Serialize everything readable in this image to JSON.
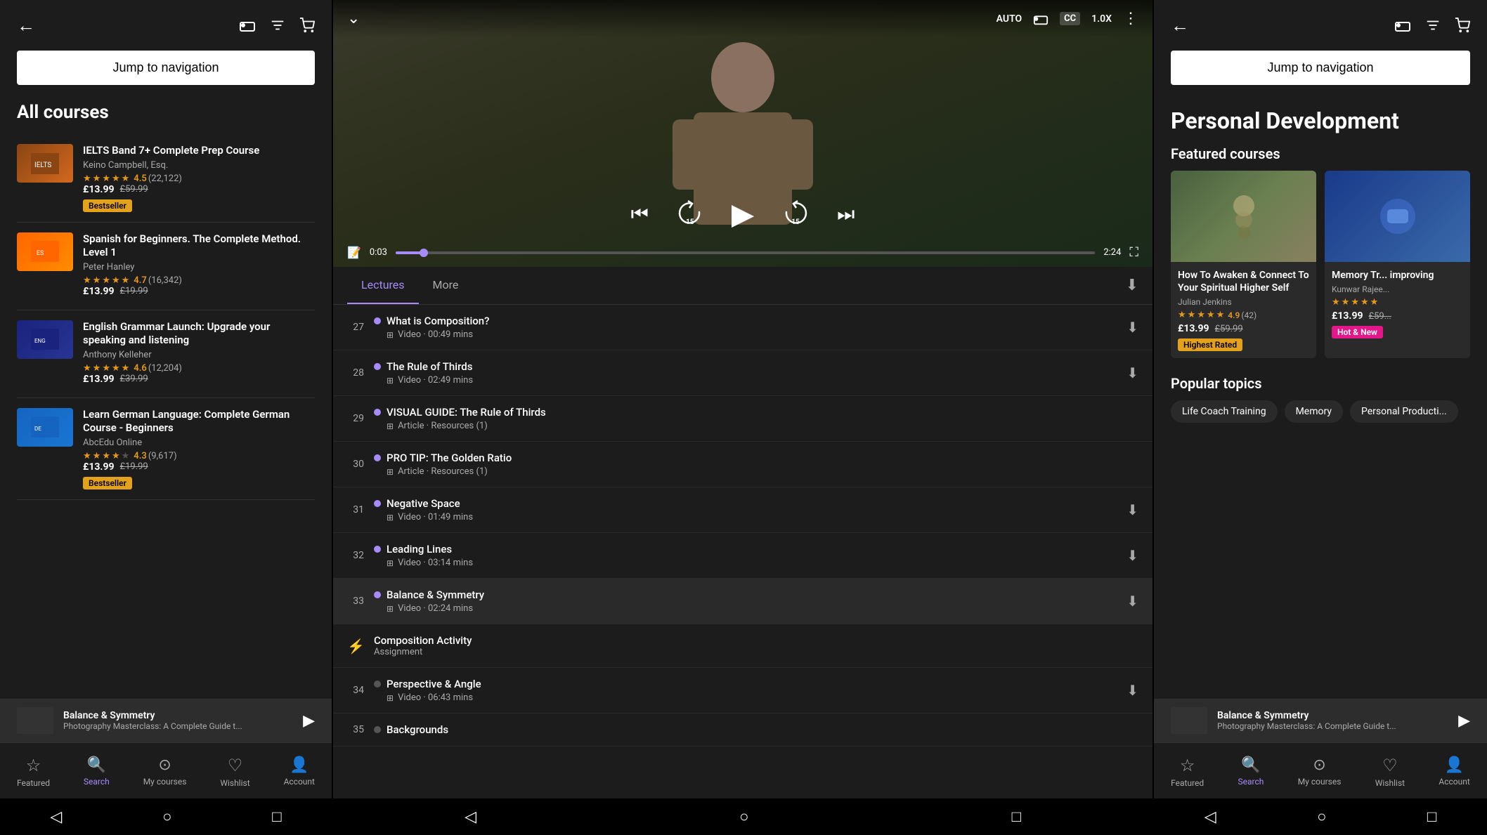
{
  "left": {
    "title": "All courses",
    "jump_nav": "Jump to navigation",
    "courses": [
      {
        "id": "ielts",
        "title": "IELTS Band 7+ Complete Prep Course",
        "author": "Keino Campbell, Esq.",
        "rating": "4.5",
        "rating_count": "(22,122)",
        "price": "£13.99",
        "original_price": "£59.99",
        "badge": "Bestseller",
        "badge_type": "bestseller",
        "stars": [
          1,
          1,
          1,
          1,
          0.5
        ]
      },
      {
        "id": "spanish",
        "title": "Spanish for Beginners. The Complete Method. Level 1",
        "author": "Peter Hanley",
        "rating": "4.7",
        "rating_count": "(16,342)",
        "price": "£13.99",
        "original_price": "£19.99",
        "badge": "",
        "badge_type": "",
        "stars": [
          1,
          1,
          1,
          1,
          1
        ]
      },
      {
        "id": "english",
        "title": "English Grammar Launch: Upgrade your speaking and listening",
        "author": "Anthony Kelleher",
        "rating": "4.6",
        "rating_count": "(12,204)",
        "price": "£13.99",
        "original_price": "£39.99",
        "badge": "",
        "badge_type": "",
        "stars": [
          1,
          1,
          1,
          1,
          0.5
        ]
      },
      {
        "id": "german",
        "title": "Learn German Language: Complete German Course - Beginners",
        "author": "AbcEdu Online",
        "rating": "4.3",
        "rating_count": "(9,617)",
        "price": "£13.99",
        "original_price": "£19.99",
        "badge": "Bestseller",
        "badge_type": "bestseller",
        "stars": [
          1,
          1,
          1,
          1,
          0
        ]
      }
    ],
    "mini_player": {
      "title": "Balance & Symmetry",
      "subtitle": "Photography Masterclass: A Complete Guide t..."
    },
    "bottom_nav": [
      {
        "id": "featured",
        "label": "Featured",
        "icon": "☆",
        "active": false
      },
      {
        "id": "search",
        "label": "Search",
        "icon": "🔍",
        "active": true
      },
      {
        "id": "mycourses",
        "label": "My courses",
        "icon": "▶",
        "active": false
      },
      {
        "id": "wishlist",
        "label": "Wishlist",
        "icon": "♡",
        "active": false
      },
      {
        "id": "account",
        "label": "Account",
        "icon": "👤",
        "active": false
      }
    ]
  },
  "center": {
    "video": {
      "auto_label": "AUTO",
      "cc_label": "CC",
      "speed_label": "1.0X",
      "time_current": "0:03",
      "time_total": "2:24",
      "progress_pct": 4
    },
    "tabs": [
      "Lectures",
      "More"
    ],
    "active_tab": "Lectures",
    "lectures": [
      {
        "num": 27,
        "title": "What is Composition?",
        "type": "Video",
        "duration": "00:49 mins",
        "has_download": true,
        "active": false
      },
      {
        "num": 28,
        "title": "The Rule of Thirds",
        "type": "Video",
        "duration": "02:49 mins",
        "has_download": true,
        "active": false
      },
      {
        "num": 29,
        "title": "VISUAL GUIDE: The Rule of Thirds",
        "type": "Article",
        "duration": "Resources (1)",
        "has_download": false,
        "active": false
      },
      {
        "num": 30,
        "title": "PRO TIP: The Golden Ratio",
        "type": "Article",
        "duration": "Resources (1)",
        "has_download": false,
        "active": false
      },
      {
        "num": 31,
        "title": "Negative Space",
        "type": "Video",
        "duration": "01:49 mins",
        "has_download": true,
        "active": false
      },
      {
        "num": 32,
        "title": "Leading Lines",
        "type": "Video",
        "duration": "03:14 mins",
        "has_download": true,
        "active": false
      },
      {
        "num": 33,
        "title": "Balance & Symmetry",
        "type": "Video",
        "duration": "02:24 mins",
        "has_download": true,
        "active": true
      }
    ],
    "assignment": {
      "title": "Composition Activity",
      "type": "Assignment"
    },
    "lecture_34": {
      "num": 34,
      "title": "Perspective & Angle",
      "type": "Video",
      "duration": "06:43 mins"
    },
    "lecture_35_title": "Backgrounds"
  },
  "right": {
    "jump_nav": "Jump to navigation",
    "category_title": "Personal Development",
    "featured_section": "Featured courses",
    "featured_courses": [
      {
        "id": "spiritual",
        "title": "How To Awaken & Connect To Your Spiritual Higher Self",
        "author": "Julian Jenkins",
        "rating": "4.9",
        "rating_count": "(42)",
        "price": "£13.99",
        "original_price": "£59.99",
        "badge": "Highest Rated",
        "badge_type": "highest"
      },
      {
        "id": "memory",
        "title": "Memory Tr... improving",
        "author": "Kunwar Rajee...",
        "rating": "4.5",
        "rating_count": "",
        "price": "£13.99",
        "original_price": "£59...",
        "badge": "Hot & New",
        "badge_type": "hotnew"
      }
    ],
    "popular_topics_title": "Popular topics",
    "topics": [
      "Life Coach Training",
      "Memory",
      "Personal Producti..."
    ],
    "mini_player": {
      "title": "Balance & Symmetry",
      "subtitle": "Photography Masterclass: A Complete Guide t..."
    },
    "bottom_nav": [
      {
        "id": "featured",
        "label": "Featured",
        "icon": "☆",
        "active": false
      },
      {
        "id": "search",
        "label": "Search",
        "icon": "🔍",
        "active": true
      },
      {
        "id": "mycourses",
        "label": "My courses",
        "icon": "▶",
        "active": false
      },
      {
        "id": "wishlist",
        "label": "Wishlist",
        "icon": "♡",
        "active": false
      },
      {
        "id": "account",
        "label": "Account",
        "icon": "👤",
        "active": false
      }
    ]
  }
}
